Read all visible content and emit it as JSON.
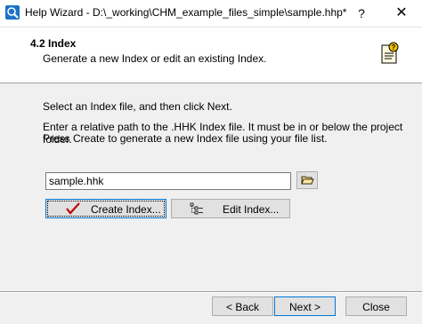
{
  "window": {
    "title": "Help Wizard - D:\\_working\\CHM_example_files_simple\\sample.hhp*",
    "help_glyph": "?",
    "close_glyph": "✕"
  },
  "header": {
    "title": "4.2 Index",
    "subtitle": "Generate a new Index or edit an existing Index."
  },
  "content": {
    "instruction": "Select an Index file, and then click Next.",
    "description_line1": "Enter a relative path to the .HHK Index file. It must be in or below the project folder.",
    "description_line2": "Press Create to generate a new Index file using your file list.",
    "file_value": "sample.hhk",
    "create_label": "Create Index...",
    "edit_label": "Edit Index..."
  },
  "footer": {
    "back_label": "< Back",
    "next_label": "Next >",
    "close_label": "Close"
  },
  "colors": {
    "accent": "#0078d7",
    "check": "#c00000"
  }
}
